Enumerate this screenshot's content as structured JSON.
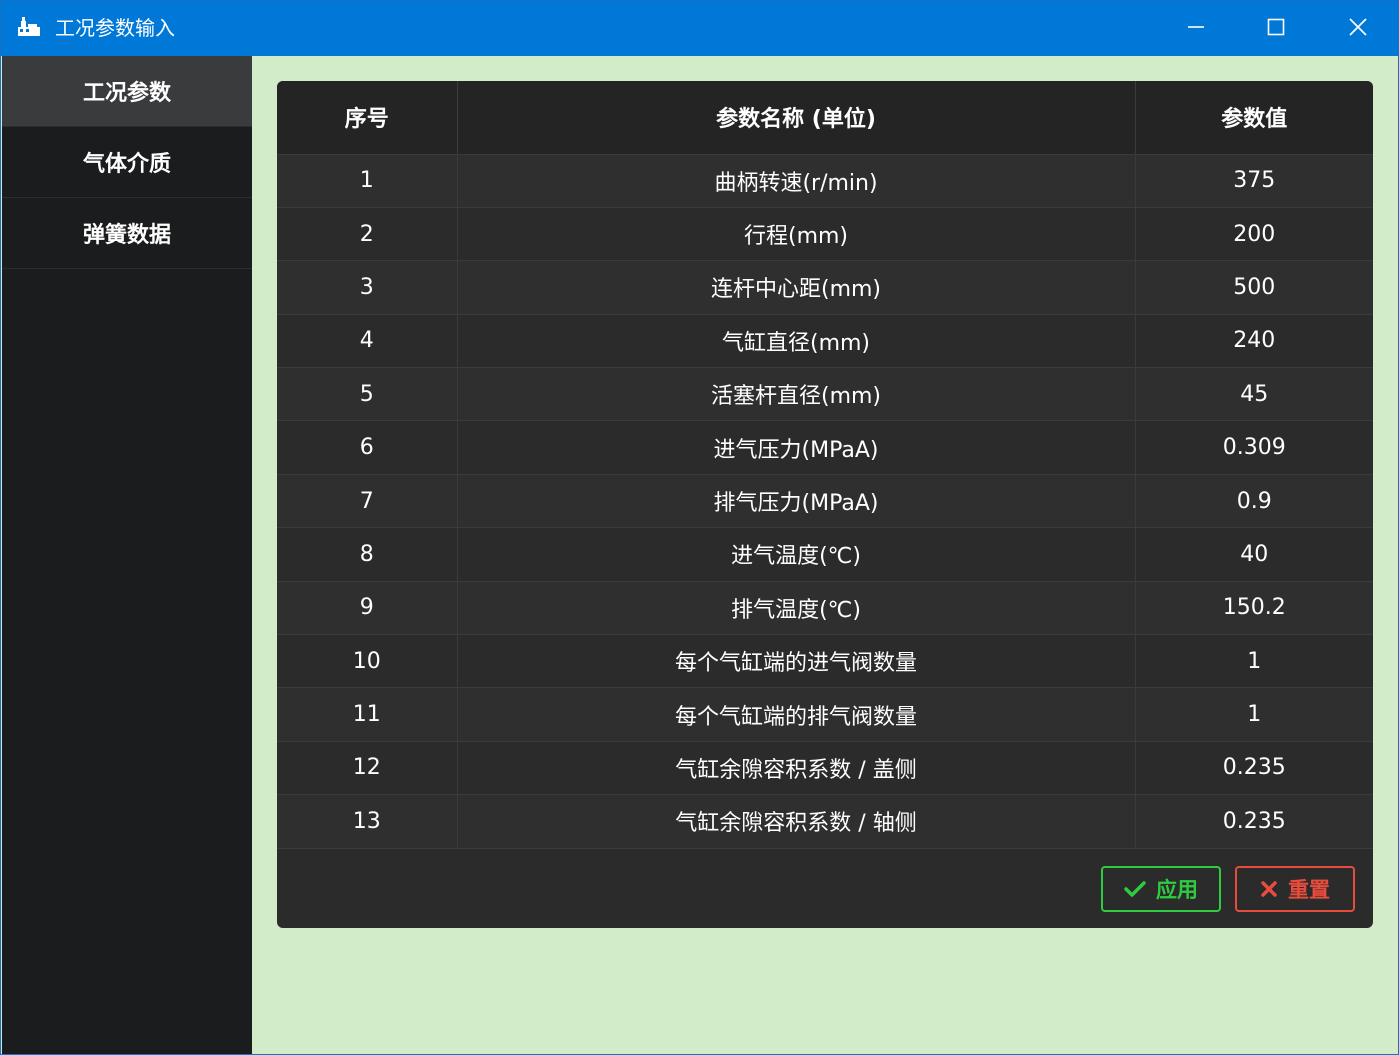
{
  "window": {
    "title": "工况参数输入",
    "controls": [
      "minimize-icon",
      "maximize-icon",
      "close-icon"
    ]
  },
  "sidebar": {
    "items": [
      {
        "label": "工况参数",
        "active": true
      },
      {
        "label": "气体介质",
        "active": false
      },
      {
        "label": "弹簧数据",
        "active": false
      }
    ]
  },
  "table": {
    "headers": [
      "序号",
      "参数名称 (单位)",
      "参数值"
    ],
    "rows": [
      {
        "index": "1",
        "name": "曲柄转速(r/min)",
        "value": "375"
      },
      {
        "index": "2",
        "name": "行程(mm)",
        "value": "200"
      },
      {
        "index": "3",
        "name": "连杆中心距(mm)",
        "value": "500"
      },
      {
        "index": "4",
        "name": "气缸直径(mm)",
        "value": "240"
      },
      {
        "index": "5",
        "name": "活塞杆直径(mm)",
        "value": "45"
      },
      {
        "index": "6",
        "name": "进气压力(MPaA)",
        "value": "0.309"
      },
      {
        "index": "7",
        "name": "排气压力(MPaA)",
        "value": "0.9"
      },
      {
        "index": "8",
        "name": "进气温度(℃)",
        "value": "40"
      },
      {
        "index": "9",
        "name": "排气温度(℃)",
        "value": "150.2"
      },
      {
        "index": "10",
        "name": "每个气缸端的进气阀数量",
        "value": "1"
      },
      {
        "index": "11",
        "name": "每个气缸端的排气阀数量",
        "value": "1"
      },
      {
        "index": "12",
        "name": "气缸余隙容积系数 / 盖侧",
        "value": "0.235"
      },
      {
        "index": "13",
        "name": "气缸余隙容积系数 / 轴侧",
        "value": "0.235"
      }
    ]
  },
  "actions": {
    "apply_label": "应用",
    "apply_icon": "check-icon",
    "reset_label": "重置",
    "reset_icon": "x-icon"
  },
  "colors": {
    "titlebar": "#0078d7",
    "background": "#d2ebc8",
    "sidebar": "#1b1c1e",
    "panel": "#2b2b2b",
    "apply": "#2ecc40",
    "reset": "#e74c3c"
  }
}
